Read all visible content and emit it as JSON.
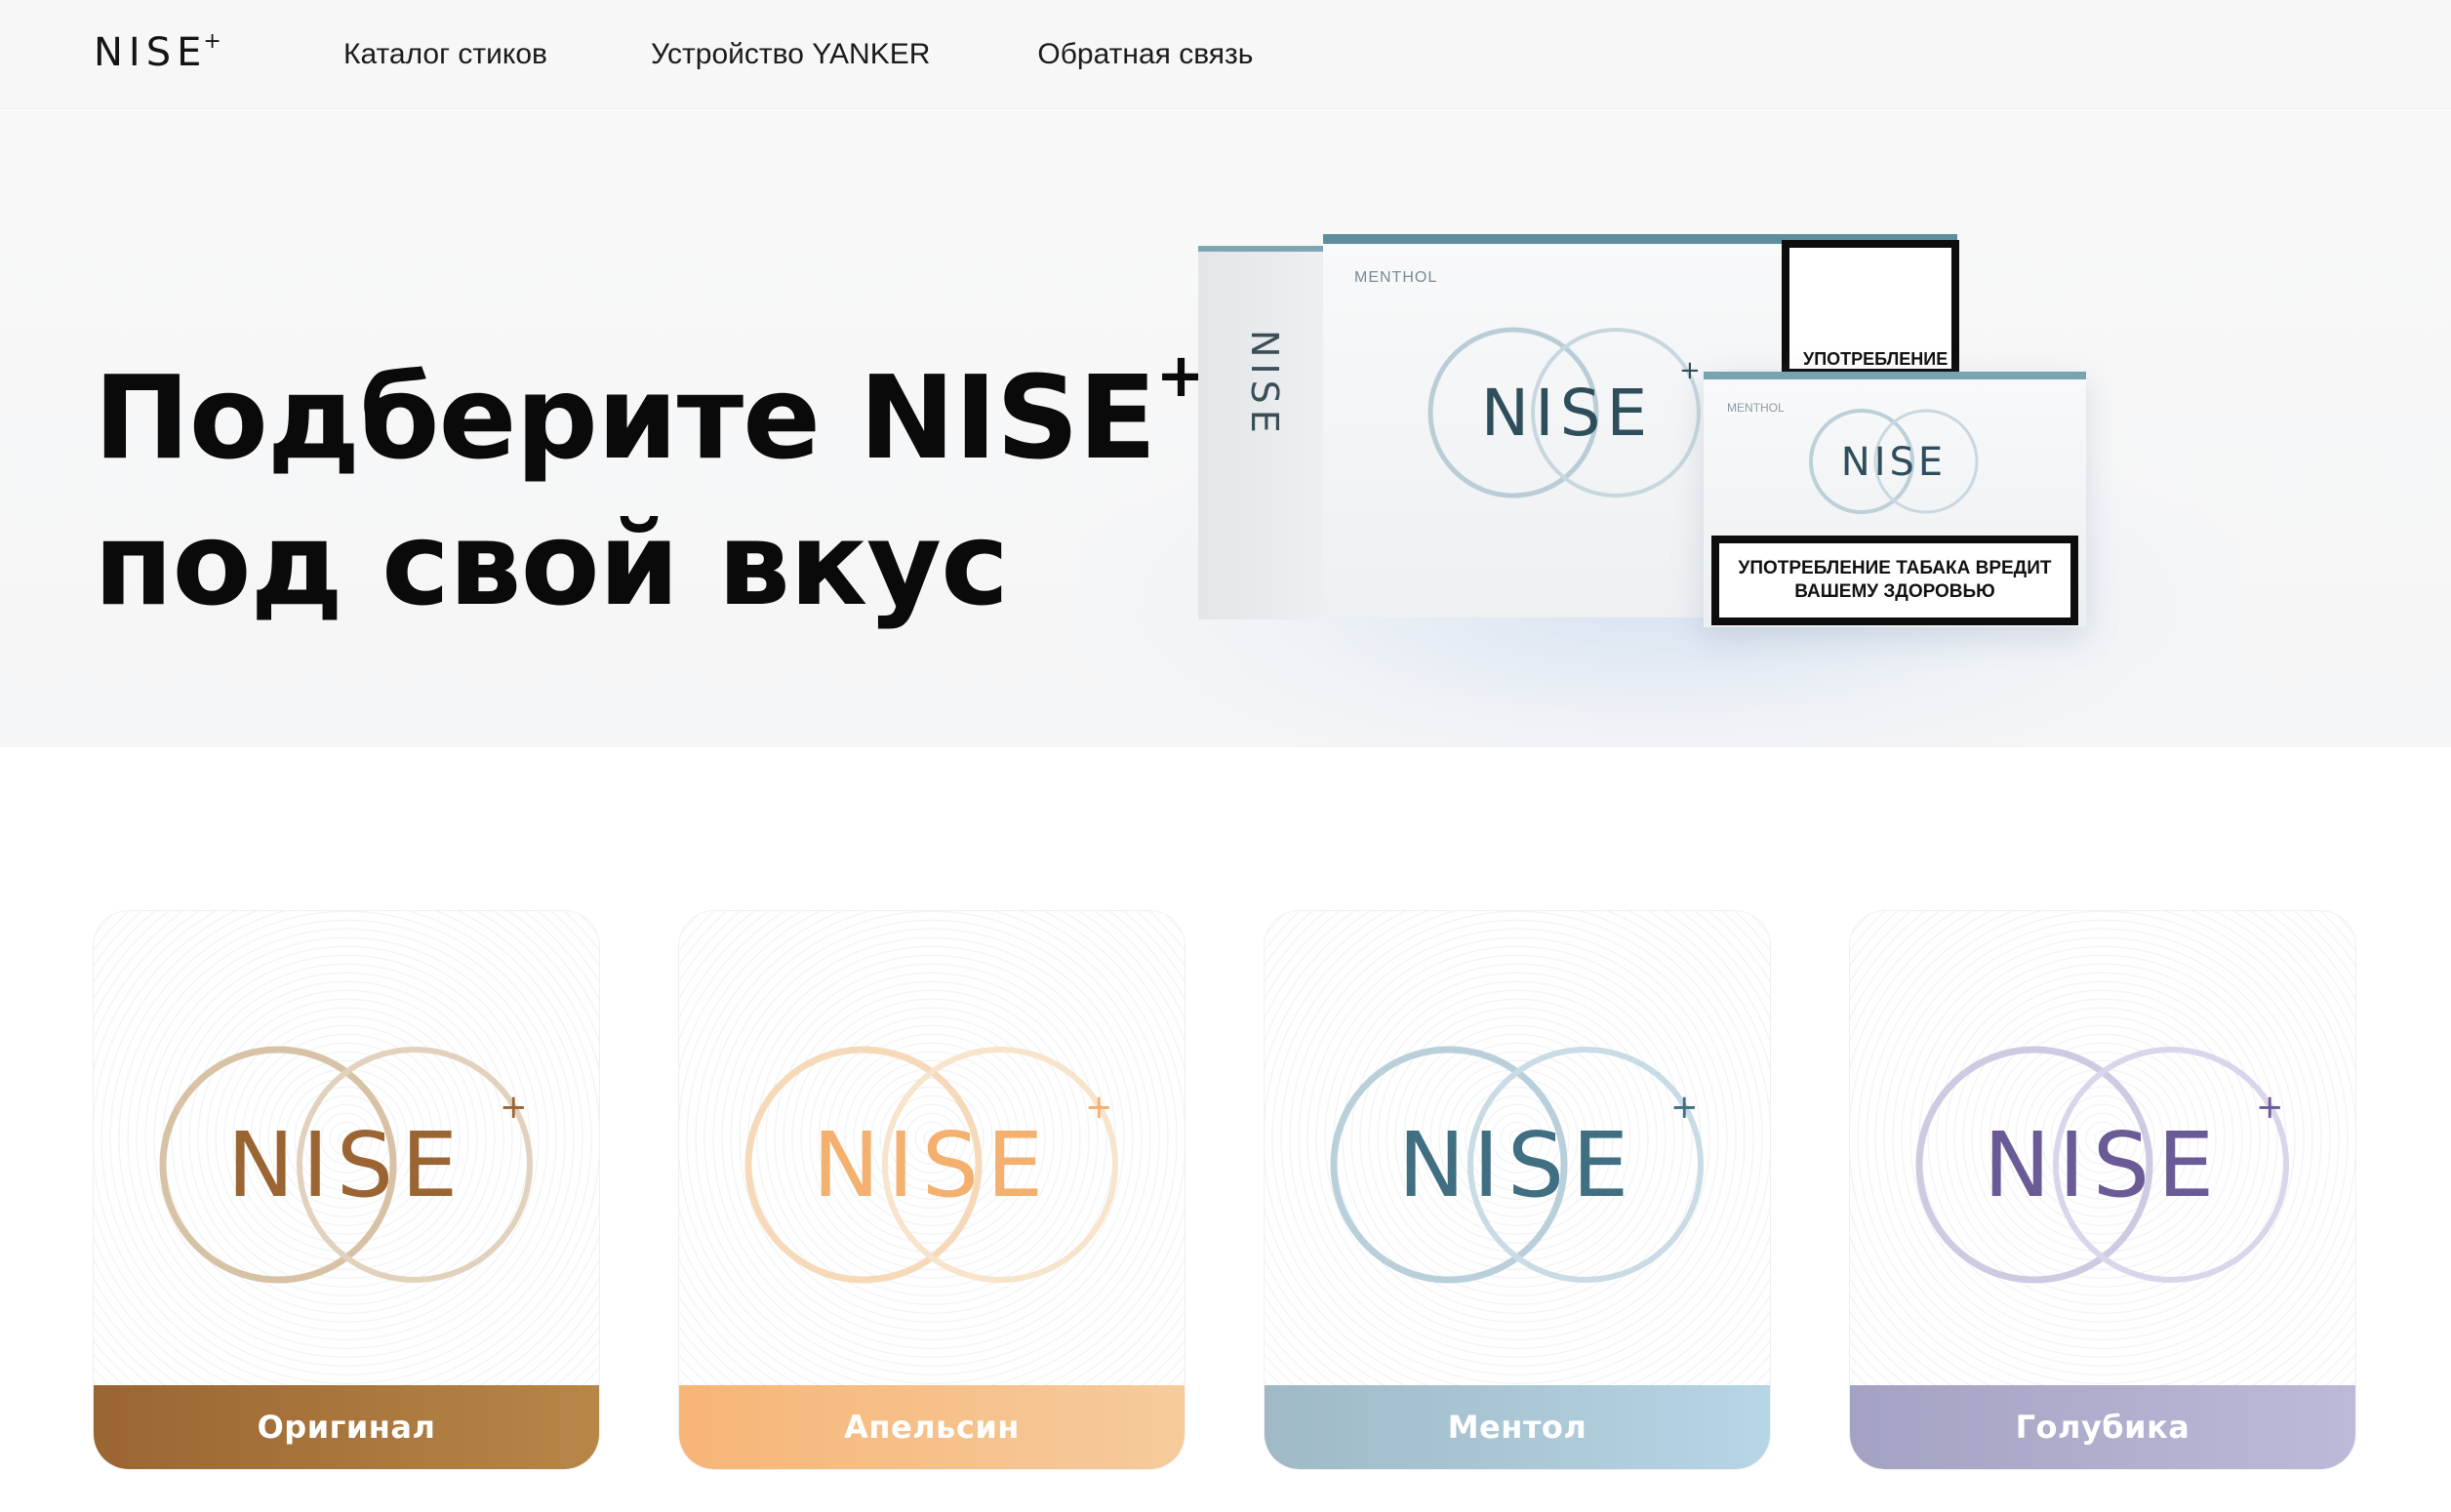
{
  "header": {
    "logo_text": "NISE",
    "logo_plus": "+",
    "nav": [
      {
        "label": "Каталог стиков"
      },
      {
        "label": "Устройство YANKER"
      },
      {
        "label": "Обратная связь"
      }
    ]
  },
  "hero": {
    "title_line1": "Подберите NISE",
    "title_plus": "+",
    "title_line2": "под свой вкус",
    "big_box": {
      "flavor": "MENTHOL",
      "side_brand": "NISE",
      "brand": "NISE",
      "brand_plus": "+",
      "warning_top": "УПОТРЕБЛЕНИЕ"
    },
    "small_box": {
      "flavor": "MENTHOL",
      "brand": "NISE",
      "warning": "УПОТРЕБЛЕНИЕ ТАБАКА ВРЕДИТ ВАШЕМУ ЗДОРОВЬЮ"
    }
  },
  "products": [
    {
      "name": "Оригинал",
      "brand": "NISE",
      "plus": "+",
      "color": "#9a6532"
    },
    {
      "name": "Апельсин",
      "brand": "NISE",
      "plus": "+",
      "color": "#f3b06e"
    },
    {
      "name": "Ментол",
      "brand": "NISE",
      "plus": "+",
      "color": "#3f6f80"
    },
    {
      "name": "Голубика",
      "brand": "NISE",
      "plus": "+",
      "color": "#6a5a95"
    }
  ]
}
